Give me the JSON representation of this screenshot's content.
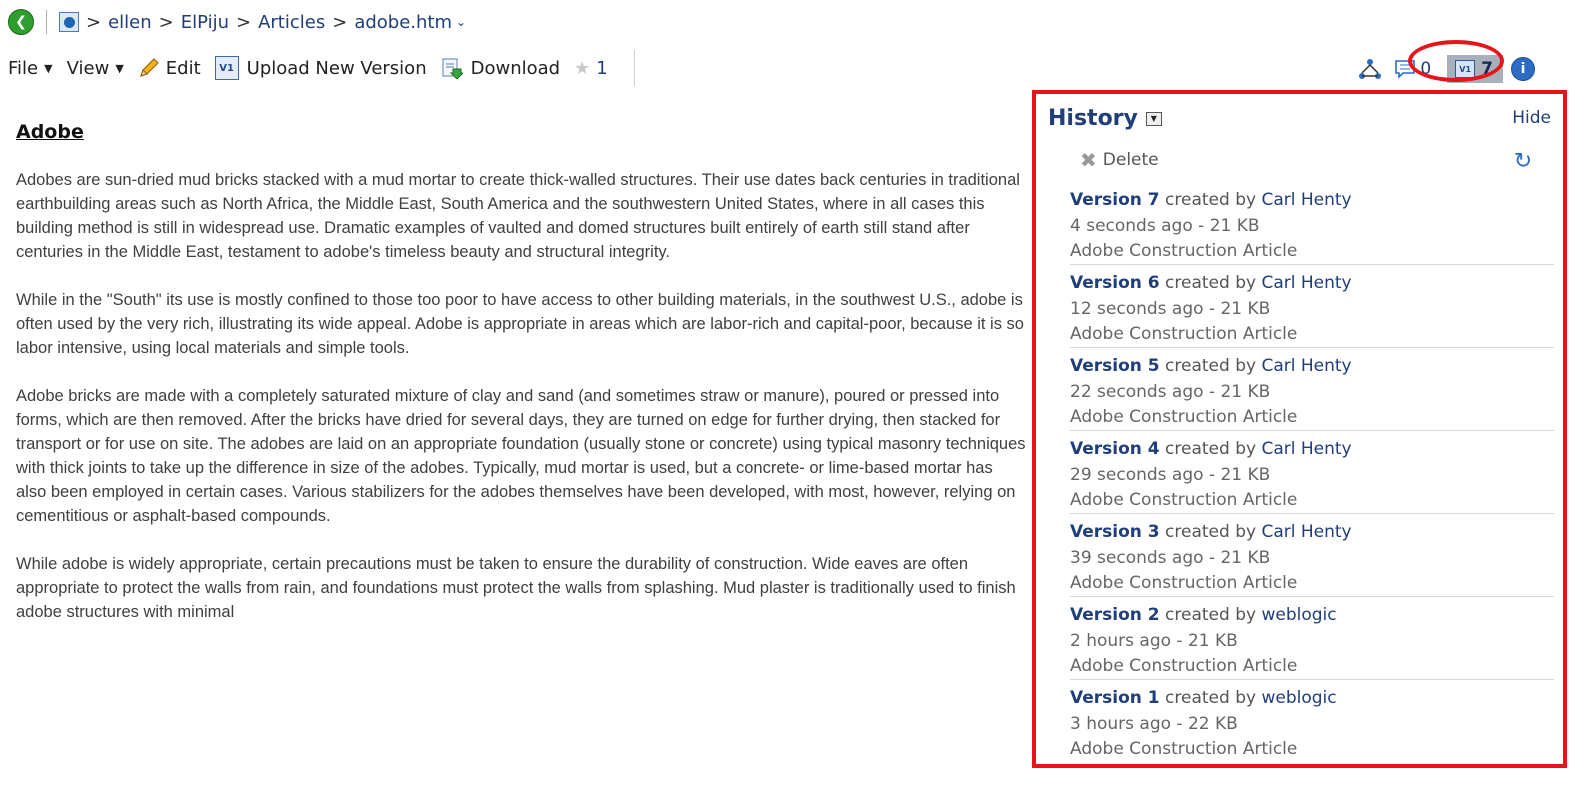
{
  "breadcrumb": {
    "segments": [
      "ellen",
      "ElPiju",
      "Articles",
      "adobe.htm"
    ],
    "separator": ">"
  },
  "toolbar": {
    "file_label": "File",
    "view_label": "View",
    "edit_label": "Edit",
    "upload_label": "Upload New Version",
    "download_label": "Download",
    "rating_count": "1"
  },
  "right_icons": {
    "comment_count": "0",
    "version_count": "7"
  },
  "article": {
    "title": "Adobe",
    "paragraphs": [
      "Adobes are sun-dried mud bricks stacked with a mud mortar to create thick-walled structures. Their use dates back centuries in traditional earthbuilding areas such as North Africa, the Middle East, South America and the southwestern United States, where in all cases this building method is still in widespread use. Dramatic examples of vaulted and domed structures built entirely of earth still stand after centuries in the Middle East, testament to adobe's timeless beauty and structural integrity.",
      "While in the \"South\" its use is mostly confined to those too poor to have access to other building materials, in the southwest U.S., adobe is often used by the very rich, illustrating its wide appeal. Adobe is appropriate in areas which are labor-rich and capital-poor, because it is so labor intensive, using local materials and simple tools.",
      "Adobe bricks are made with a completely saturated mixture of clay and sand (and sometimes straw or manure), poured or pressed into forms, which are then removed. After the bricks have dried for several days, they are turned on edge for further drying, then stacked for transport or for use on site. The adobes are laid on an appropriate foundation (usually stone or concrete) using typical masonry techniques with thick joints to take up the difference in size of the adobes. Typically, mud mortar is used, but a concrete- or lime-based mortar has also been employed in certain cases. Various stabilizers for the adobes themselves have been developed, with most, however, relying on cementitious or asphalt-based compounds.",
      "While adobe is widely appropriate, certain precautions must be taken to ensure the durability of construction. Wide eaves are often appropriate to protect the walls from rain, and foundations must protect the walls from splashing. Mud plaster is traditionally used to finish adobe structures with minimal"
    ]
  },
  "history": {
    "title": "History",
    "hide_label": "Hide",
    "delete_label": "Delete",
    "created_by_label": "created by",
    "versions": [
      {
        "version": "Version 7",
        "user": "Carl Henty",
        "meta": "4 seconds ago  -  21 KB",
        "description": "Adobe Construction Article"
      },
      {
        "version": "Version 6",
        "user": "Carl Henty",
        "meta": "12 seconds ago  -  21 KB",
        "description": "Adobe Construction Article"
      },
      {
        "version": "Version 5",
        "user": "Carl Henty",
        "meta": "22 seconds ago  -  21 KB",
        "description": "Adobe Construction Article"
      },
      {
        "version": "Version 4",
        "user": "Carl Henty",
        "meta": "29 seconds ago  -  21 KB",
        "description": "Adobe Construction Article"
      },
      {
        "version": "Version 3",
        "user": "Carl Henty",
        "meta": "39 seconds ago  -  21 KB",
        "description": "Adobe Construction Article"
      },
      {
        "version": "Version 2",
        "user": "weblogic",
        "meta": "2 hours ago  -  21 KB",
        "description": "Adobe Construction Article"
      },
      {
        "version": "Version 1",
        "user": "weblogic",
        "meta": "3 hours ago  -  22 KB",
        "description": "Adobe Construction Article"
      }
    ]
  },
  "colors": {
    "highlight": "#e8141a",
    "link": "#1f3e7a"
  }
}
